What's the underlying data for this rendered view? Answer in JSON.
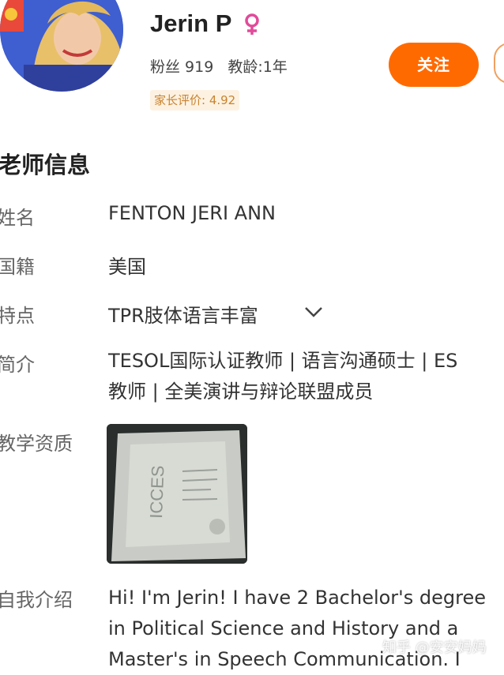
{
  "teacher": {
    "name": "Jerin P",
    "fans_label": "粉丝 919",
    "teaching_years": "教龄:1年",
    "parent_rating": "家长评价: 4.92",
    "follow_label": "关注"
  },
  "info_section": {
    "title": "老师信息",
    "name_label": "姓名",
    "name_value": "FENTON JERI ANN",
    "nationality_label": "国籍",
    "nationality_value": "美国",
    "feature_label": "特点",
    "feature_value": "TPR肢体语言丰富",
    "intro_label": "简介",
    "intro_lines": [
      "TESOL国际认证教师 | 语言沟通硕士 | ES",
      "教师 | 全美演讲与辩论联盟成员"
    ],
    "qualification_label": "教学资质",
    "self_intro_label": "自我介绍",
    "self_intro_lines": [
      "Hi!  I'm Jerin!  I have 2 Bachelor's degree",
      "in Political Science and History and a",
      "Master's in Speech Communication.  I"
    ]
  },
  "watermark": "知乎 @安安妈妈",
  "colors": {
    "accent": "#ff6a00",
    "badge_bg": "#fdf2e2",
    "badge_text": "#c9832f",
    "gender_icon": "#e24a9a"
  },
  "icons": {
    "gender": "female-symbol-icon",
    "expand": "chevron-down-icon"
  }
}
